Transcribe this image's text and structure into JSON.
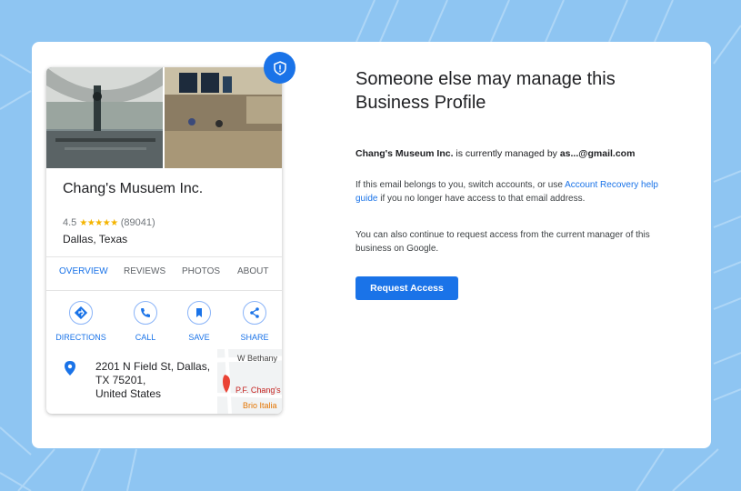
{
  "colors": {
    "background": "#8ec5f2",
    "accent": "#1a73e8",
    "star": "#f4b400",
    "text": "#202124"
  },
  "listing": {
    "name": "Chang's Musuem Inc.",
    "rating": "4.5",
    "stars": "★★★★★",
    "review_count": "(89041)",
    "location": "Dallas, Texas",
    "tabs": [
      {
        "label": "OVERVIEW",
        "active": true
      },
      {
        "label": "REVIEWS",
        "active": false
      },
      {
        "label": "PHOTOS",
        "active": false
      },
      {
        "label": "ABOUT",
        "active": false
      }
    ],
    "actions": [
      {
        "label": "DIRECTIONS",
        "icon": "directions-icon"
      },
      {
        "label": "CALL",
        "icon": "phone-icon"
      },
      {
        "label": "SAVE",
        "icon": "bookmark-icon"
      },
      {
        "label": "SHARE",
        "icon": "share-icon"
      }
    ],
    "address_line1": "2201 N Field St, Dallas,",
    "address_line2": "TX 75201,",
    "address_line3": "United States",
    "map": {
      "street_label": "W Bethany",
      "place_label": "P.F. Chang's",
      "place2_label": "Brio Italia"
    }
  },
  "shield_badge": {
    "icon": "shield-icon"
  },
  "main": {
    "heading": "Someone else may manage this Business Profile",
    "managed_business": "Chang's Museum Inc.",
    "managed_mid": " is currently managed by ",
    "managed_email": "as...@gmail.com",
    "para1_before": "If this email belongs to you, switch accounts, or use ",
    "para1_link": "Account Recovery help guide",
    "para1_after": " if you no longer have access to that email address.",
    "para2": "You can also continue to request access from the current manager of this business on Google.",
    "request_button": "Request Access"
  }
}
